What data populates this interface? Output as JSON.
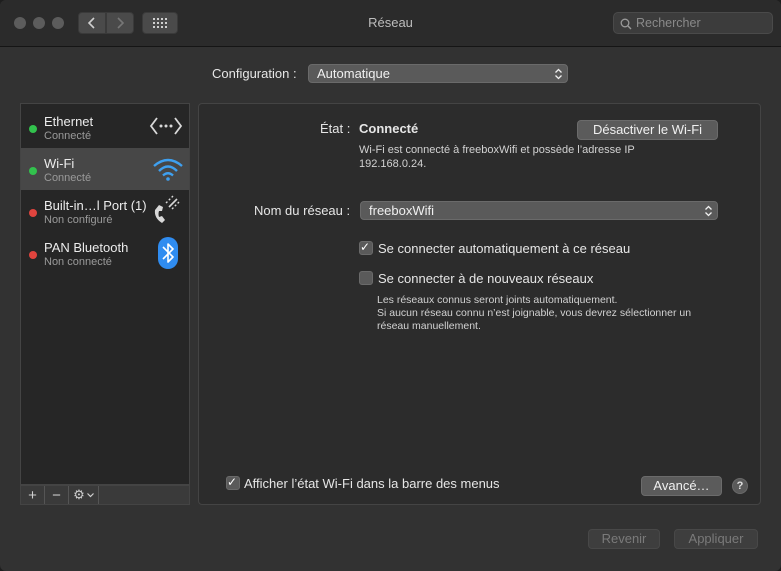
{
  "window": {
    "title": "Réseau"
  },
  "search": {
    "placeholder": "Rechercher"
  },
  "configuration": {
    "label": "Configuration :",
    "value": "Automatique"
  },
  "services": [
    {
      "name": "Ethernet",
      "status": "Connecté",
      "state": "green",
      "icon": "ethernet-arrows-icon"
    },
    {
      "name": "Wi-Fi",
      "status": "Connecté",
      "state": "green",
      "icon": "wifi-icon"
    },
    {
      "name": "Built-in…l Port (1)",
      "status": "Non configuré",
      "state": "red",
      "icon": "phone-icon"
    },
    {
      "name": "PAN Bluetooth",
      "status": "Non connecté",
      "state": "red",
      "icon": "bluetooth-icon"
    }
  ],
  "sidebar_toolbar": {
    "add": "+",
    "remove": "−",
    "action": "⚙"
  },
  "wifi": {
    "state_label": "État :",
    "state_value": "Connecté",
    "toggle_button": "Désactiver le Wi-Fi",
    "info_line1": "Wi-Fi est connecté à freeboxWifi et possède l’adresse IP",
    "info_line2": "192.168.0.24.",
    "network_label": "Nom du réseau :",
    "network_value": "freeboxWifi",
    "auto_connect": {
      "label": "Se connecter automatiquement à ce réseau",
      "checked": true
    },
    "ask_new": {
      "label": "Se connecter à de nouveaux réseaux",
      "checked": false
    },
    "help_line1": "Les réseaux connus seront joints automatiquement.",
    "help_line2": "Si aucun réseau connu n’est joignable, vous devrez sélectionner un",
    "help_line3": "réseau manuellement.",
    "show_in_menubar": {
      "label": "Afficher l’état Wi-Fi dans la barre des menus",
      "checked": true
    },
    "advanced_button": "Avancé…",
    "help_button": "?"
  },
  "footer": {
    "revert": "Revenir",
    "apply": "Appliquer"
  },
  "colors": {
    "green": "#32c24d",
    "red": "#e0443e",
    "wifi_blue": "#3ea0f0",
    "bluetooth_blue": "#2f8cf0"
  }
}
